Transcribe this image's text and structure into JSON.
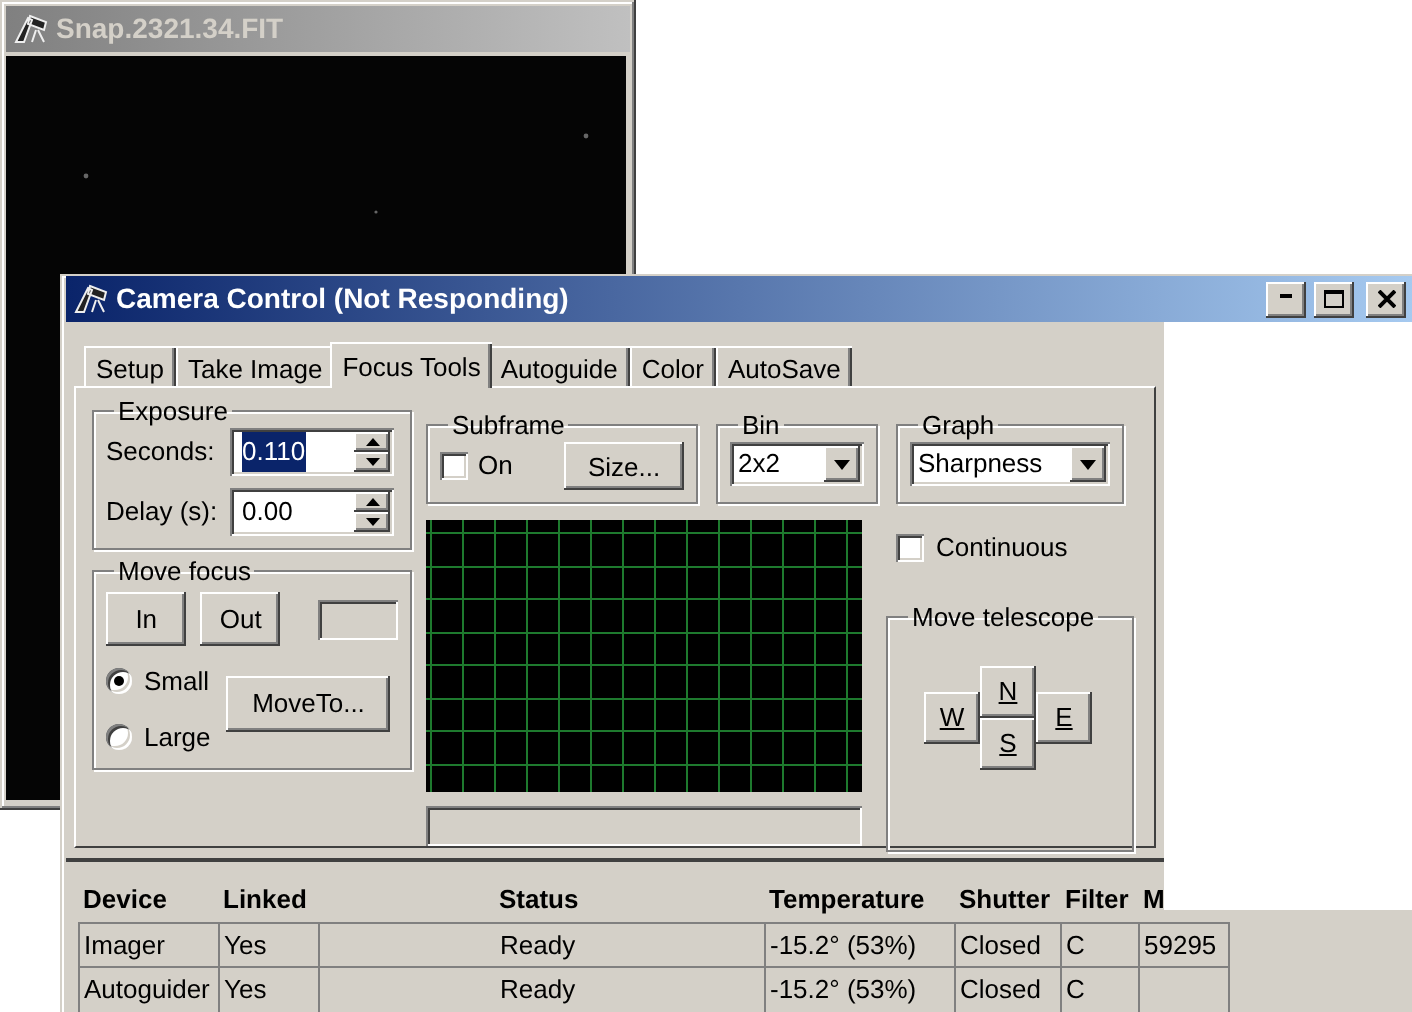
{
  "image_window": {
    "title": "Snap.2321.34.FIT",
    "active": false
  },
  "camera_window": {
    "title": "Camera Control (Not Responding)",
    "active": true
  },
  "tabs": [
    {
      "label": "Setup",
      "selected": false
    },
    {
      "label": "Take Image",
      "selected": false
    },
    {
      "label": "Focus Tools",
      "selected": true
    },
    {
      "label": "Autoguide",
      "selected": false
    },
    {
      "label": "Color",
      "selected": false
    },
    {
      "label": "AutoSave",
      "selected": false
    }
  ],
  "exposure": {
    "title": "Exposure",
    "seconds": {
      "label": "Seconds:",
      "value": "0.110",
      "highlighted": true
    },
    "delay": {
      "label": "Delay (s):",
      "value": "0.00",
      "highlighted": false
    }
  },
  "move_focus": {
    "title": "Move focus",
    "in_button": {
      "label": "In"
    },
    "out_button": {
      "label": "Out"
    },
    "step_sizes": [
      {
        "label": "Small",
        "selected": true
      },
      {
        "label": "Large",
        "selected": false
      }
    ],
    "move_to_button": {
      "label": "MoveTo..."
    }
  },
  "subframe": {
    "title": "Subframe",
    "checkbox": {
      "label": "On",
      "checked": false
    },
    "size_button": {
      "label": "Size..."
    }
  },
  "bin": {
    "title": "Bin",
    "value": "2x2"
  },
  "graph": {
    "title": "Graph",
    "value": "Sharpness"
  },
  "continuous": {
    "label": "Continuous",
    "checked": false
  },
  "move_telescope": {
    "title": "Move telescope",
    "buttons": [
      {
        "label": "N",
        "kind": "north"
      },
      {
        "label": "W",
        "kind": "west"
      },
      {
        "label": "E",
        "kind": "east"
      },
      {
        "label": "S",
        "kind": "south"
      }
    ]
  },
  "table": {
    "columns": [
      "Device",
      "Linked",
      "Status",
      "Temperature",
      "Shutter",
      "Filter",
      "M"
    ],
    "rows": [
      [
        "Imager",
        "Yes",
        "Ready",
        "-15.2° (53%)",
        "Closed",
        "C",
        "59295"
      ],
      [
        "Autoguider",
        "Yes",
        "Ready",
        "-15.2° (53%)",
        "Closed",
        "C"
      ]
    ]
  }
}
